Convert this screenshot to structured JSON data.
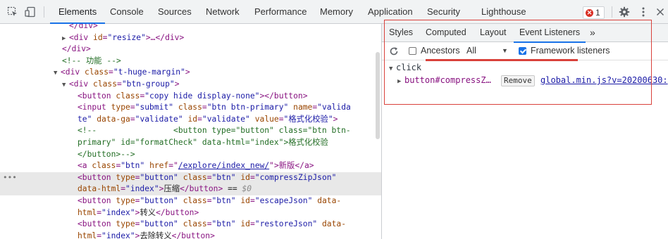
{
  "toolbar": {
    "tabs": [
      {
        "label": "Elements",
        "active": true
      },
      {
        "label": "Console"
      },
      {
        "label": "Sources"
      },
      {
        "label": "Network"
      },
      {
        "label": "Performance"
      },
      {
        "label": "Memory"
      },
      {
        "label": "Application"
      },
      {
        "label": "Security"
      },
      {
        "label": "Lighthouse"
      }
    ],
    "error_count": "1",
    "icons": [
      "inspect-element-icon",
      "device-toolbar-icon",
      "settings-gear-icon",
      "more-menu-icon",
      "close-icon"
    ]
  },
  "dom": {
    "l0": {
      "t1": "</div>"
    },
    "l1": {
      "t1": "<div",
      "a1": "id",
      "v1": "\"resize\"",
      "t2": ">…</div>"
    },
    "l2": {
      "t1": "</div>"
    },
    "l3": {
      "c": "<!-- 功能 -->"
    },
    "l4": {
      "t1": "<div",
      "a1": "class",
      "v1": "\"t-huge-margin\"",
      "t2": ">"
    },
    "l5": {
      "t1": "<div",
      "a1": "class",
      "v1": "\"btn-group\"",
      "t2": ">"
    },
    "l6": {
      "t1": "<button",
      "a1": "class",
      "v1": "\"copy hide display-none\"",
      "t2": "></button>"
    },
    "l7": {
      "t1": "<input",
      "a1": "type",
      "v1": "\"submit\"",
      "a2": "class",
      "v2": "\"btn btn-primary\"",
      "a3": "name",
      "v3": "\"valida"
    },
    "l8": {
      "v1": "te\"",
      "a1": "data-ga",
      "v2": "\"validate\"",
      "a2": "id",
      "v3": "\"validate\"",
      "a3": "value",
      "v4": "\"格式化校验\"",
      "t1": ">"
    },
    "l9": {
      "c": "<!--                <button type=\"button\" class=\"btn btn-"
    },
    "l10": {
      "c": "primary\" id=\"formatCheck\" data-html=\"index\">格式化校验"
    },
    "l11": {
      "c": "</button>-->"
    },
    "l12": {
      "t1": "<a",
      "a1": "class",
      "v1": "\"btn\"",
      "a2": "href",
      "link": "/explore/index_new/",
      "t2": ">新版</a>"
    },
    "l13": {
      "t1": "<button",
      "a1": "type",
      "v1": "\"button\"",
      "a2": "class",
      "v2": "\"btn\"",
      "a3": "id",
      "v3": "\"compressZipJson\""
    },
    "l14": {
      "a1": "data-html",
      "v1": "\"index\"",
      "t1": ">",
      "txt": "压缩",
      "t2": "</button>",
      "eq": " == ",
      "d": "$0"
    },
    "l15": {
      "t1": "<button",
      "a1": "type",
      "v1": "\"button\"",
      "a2": "class",
      "v2": "\"btn\"",
      "a3": "id",
      "v3": "\"escapeJson\"",
      "a4": "data-"
    },
    "l16": {
      "a1": "html",
      "v1": "\"index\"",
      "t1": ">",
      "txt": "转义",
      "t2": "</button>"
    },
    "l17": {
      "t1": "<button",
      "a1": "type",
      "v1": "\"button\"",
      "a2": "class",
      "v2": "\"btn\"",
      "a3": "id",
      "v3": "\"restoreJson\"",
      "a4": "data-"
    },
    "l18": {
      "a1": "html",
      "v1": "\"index\"",
      "t1": ">",
      "txt": "去除转义",
      "t2": "</button>"
    }
  },
  "right_panel": {
    "tabs": [
      "Styles",
      "Computed",
      "Layout",
      "Event Listeners"
    ],
    "overflow": "»",
    "ancestors_label": "Ancestors",
    "ancestors_checked": false,
    "select_value": "All",
    "framework_label": "Framework listeners",
    "framework_checked": true,
    "event_type": "click",
    "listener_node": "button#compressZ…",
    "remove_label": "Remove",
    "source_link": "global.min.js?v=20200630:"
  },
  "colors": {
    "accent": "#1a73e8",
    "highlight": "#d9413b",
    "error": "#d93025"
  }
}
